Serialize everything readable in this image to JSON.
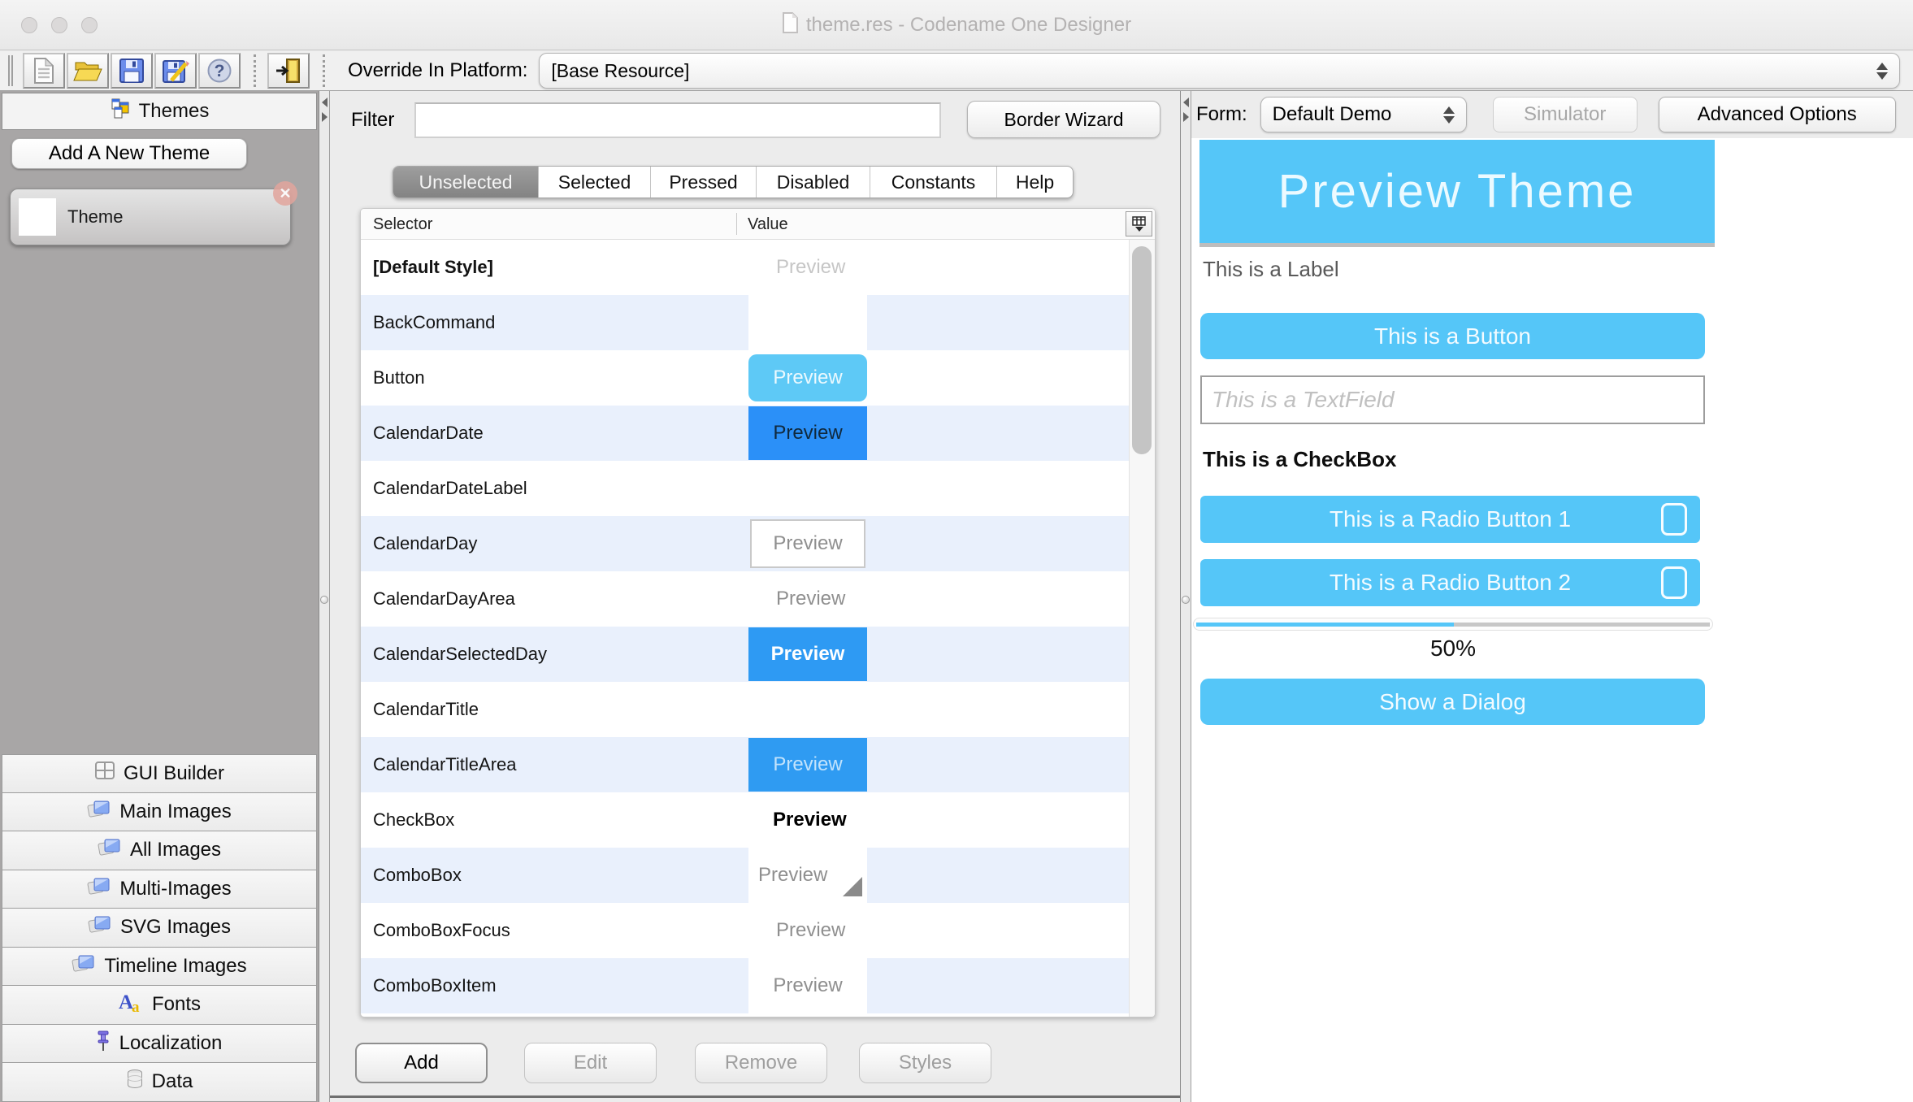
{
  "window": {
    "title": "theme.res - Codename One Designer"
  },
  "toolbar": {
    "button_groups": [
      [
        "new-file",
        "open-file",
        "save",
        "save-as",
        "help"
      ],
      [
        "exit"
      ]
    ],
    "override_label": "Override In Platform:",
    "override_value": "[Base Resource]"
  },
  "sidebar": {
    "header": "Themes",
    "header_icon": "themes",
    "add_button": "Add A New Theme",
    "theme_item": "Theme",
    "close_icon": "x",
    "sections": [
      {
        "label": "GUI Builder",
        "icon": "grid"
      },
      {
        "label": "Main Images",
        "icon": "images"
      },
      {
        "label": "All Images",
        "icon": "images"
      },
      {
        "label": "Multi-Images",
        "icon": "images"
      },
      {
        "label": "SVG Images",
        "icon": "images"
      },
      {
        "label": "Timeline Images",
        "icon": "images"
      },
      {
        "label": "Fonts",
        "icon": "fonts"
      },
      {
        "label": "Localization",
        "icon": "pin"
      },
      {
        "label": "Data",
        "icon": "database"
      }
    ]
  },
  "middle": {
    "filter_label": "Filter",
    "filter_value": "",
    "border_wizard": "Border Wizard",
    "tabs": [
      "Unselected",
      "Selected",
      "Pressed",
      "Disabled",
      "Constants",
      "Help"
    ],
    "active_tab": "Unselected",
    "columns": [
      "Selector",
      "Value"
    ],
    "rows": [
      {
        "selector": "[Default Style]",
        "bold": true,
        "value": "Preview",
        "style": "text-faint"
      },
      {
        "selector": "BackCommand",
        "value": "",
        "style": "white-cell"
      },
      {
        "selector": "Button",
        "value": "Preview",
        "style": "btn-light"
      },
      {
        "selector": "CalendarDate",
        "value": "Preview",
        "style": "btn-blue-dark"
      },
      {
        "selector": "CalendarDateLabel",
        "value": "",
        "style": "none"
      },
      {
        "selector": "CalendarDay",
        "value": "Preview",
        "style": "white-box"
      },
      {
        "selector": "CalendarDayArea",
        "value": "Preview",
        "style": "text-gray"
      },
      {
        "selector": "CalendarSelectedDay",
        "value": "Preview",
        "style": "btn-blue-bold"
      },
      {
        "selector": "CalendarTitle",
        "value": "",
        "style": "none"
      },
      {
        "selector": "CalendarTitleArea",
        "value": "Preview",
        "style": "btn-blue-soft"
      },
      {
        "selector": "CheckBox",
        "value": "Preview",
        "style": "text-bold"
      },
      {
        "selector": "ComboBox",
        "value": "Preview",
        "style": "combo"
      },
      {
        "selector": "ComboBoxFocus",
        "value": "Preview",
        "style": "text-gray"
      },
      {
        "selector": "ComboBoxItem",
        "value": "Preview",
        "style": "white-cell-text"
      }
    ],
    "actions": [
      {
        "label": "Add",
        "enabled": true
      },
      {
        "label": "Edit",
        "enabled": false
      },
      {
        "label": "Remove",
        "enabled": false
      },
      {
        "label": "Styles",
        "enabled": false
      }
    ]
  },
  "right": {
    "form_label": "Form:",
    "form_value": "Default Demo",
    "simulator": "Simulator",
    "advanced_options": "Advanced Options",
    "preview": {
      "title": "Preview Theme",
      "label": "This is a Label",
      "button": "This is a Button",
      "textfield_placeholder": "This is a TextField",
      "checkbox": "This is a CheckBox",
      "radio1": "This is a Radio Button 1",
      "radio2": "This is a Radio Button 2",
      "progress_percent": 50,
      "progress_text": "50%",
      "dialog_button": "Show a Dialog"
    }
  },
  "colors": {
    "preview_accent": "#55c6f8",
    "table_button_blue": "#2e96f5",
    "row_alt_blue": "#e9f0fc",
    "active_tab_gray": "#8e8e8e"
  }
}
